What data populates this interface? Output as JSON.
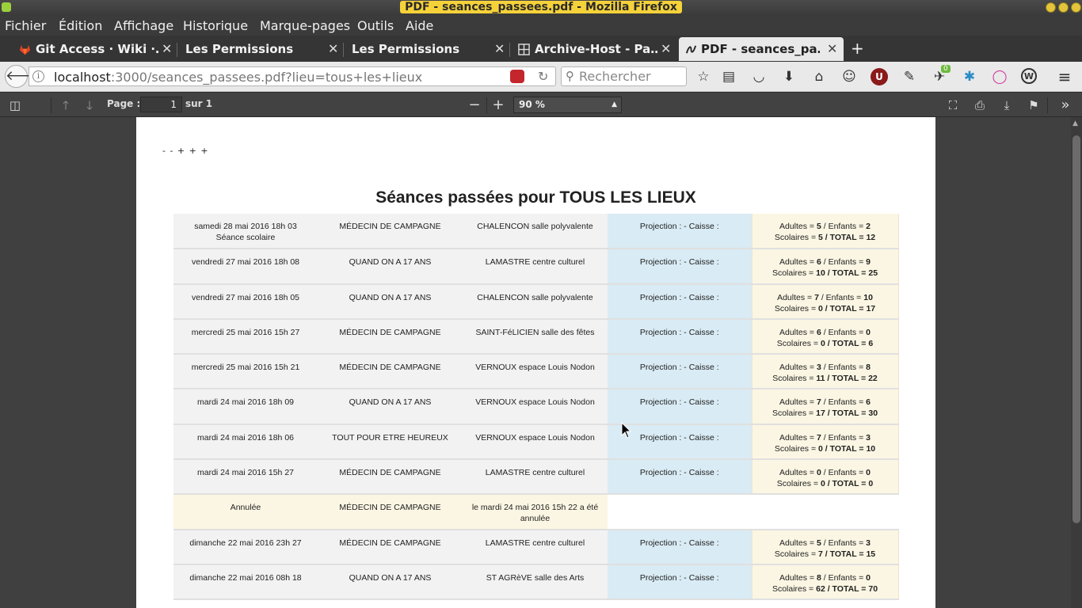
{
  "window": {
    "title": "PDF - seances_passees.pdf - Mozilla Firefox"
  },
  "menu": [
    "Fichier",
    "Édition",
    "Affichage",
    "Historique",
    "Marque-pages",
    "Outils",
    "Aide"
  ],
  "tabs": [
    {
      "label": "Git Access · Wiki ·…",
      "icon": "gitlab-icon",
      "active": false
    },
    {
      "label": "Les Permissions",
      "icon": "",
      "active": false
    },
    {
      "label": "Les Permissions",
      "icon": "",
      "active": false
    },
    {
      "label": "Archive-Host - Pa…",
      "icon": "grid-icon",
      "active": false
    },
    {
      "label": "PDF - seances_pa…",
      "icon": "pdf-icon",
      "active": true
    }
  ],
  "nav": {
    "url_host": "localhost",
    "url_rest": ":3000/seances_passees.pdf?lieu=tous+les+lieux",
    "search_placeholder": "Rechercher",
    "extension_badge": "0"
  },
  "pdf_toolbar": {
    "page_label": "Page :",
    "page_value": "1",
    "page_count": "sur 1",
    "zoom": "90 %"
  },
  "document": {
    "header_line": "- - + + +",
    "title": "Séances passées pour TOUS LES LIEUX",
    "rows": [
      {
        "date": "samedi 28 mai 2016 18h 03",
        "date_note": "Séance scolaire",
        "film": "MÉDECIN DE CAMPAGNE",
        "lieu": "CHALENCON salle polyvalente",
        "caisse": "Projection : - Caisse :",
        "adultes": "5",
        "enfants": "2",
        "scolaires": "5",
        "total": "12"
      },
      {
        "date": "vendredi 27 mai 2016 18h 08",
        "date_note": "",
        "film": "QUAND ON A 17 ANS",
        "lieu": "LAMASTRE centre culturel",
        "caisse": "Projection : - Caisse :",
        "adultes": "6",
        "enfants": "9",
        "scolaires": "10",
        "total": "25"
      },
      {
        "date": "vendredi 27 mai 2016 18h 05",
        "date_note": "",
        "film": "QUAND ON A 17 ANS",
        "lieu": "CHALENCON salle polyvalente",
        "caisse": "Projection : - Caisse :",
        "adultes": "7",
        "enfants": "10",
        "scolaires": "0",
        "total": "17"
      },
      {
        "date": "mercredi 25 mai 2016 15h 27",
        "date_note": "",
        "film": "MÉDECIN DE CAMPAGNE",
        "lieu": "SAINT-FéLICIEN salle des fêtes",
        "caisse": "Projection : - Caisse :",
        "adultes": "6",
        "enfants": "0",
        "scolaires": "0",
        "total": "6"
      },
      {
        "date": "mercredi 25 mai 2016 15h 21",
        "date_note": "",
        "film": "MÉDECIN DE CAMPAGNE",
        "lieu": "VERNOUX espace Louis Nodon",
        "caisse": "Projection : - Caisse :",
        "adultes": "3",
        "enfants": "8",
        "scolaires": "11",
        "total": "22"
      },
      {
        "date": "mardi 24 mai 2016 18h 09",
        "date_note": "",
        "film": "QUAND ON A 17 ANS",
        "lieu": "VERNOUX espace Louis Nodon",
        "caisse": "Projection : - Caisse :",
        "adultes": "7",
        "enfants": "6",
        "scolaires": "17",
        "total": "30"
      },
      {
        "date": "mardi 24 mai 2016 18h 06",
        "date_note": "",
        "film": "TOUT POUR ETRE HEUREUX",
        "lieu": "VERNOUX espace Louis Nodon",
        "caisse": "Projection : - Caisse :",
        "adultes": "7",
        "enfants": "3",
        "scolaires": "0",
        "total": "10"
      },
      {
        "date": "mardi 24 mai 2016 15h 27",
        "date_note": "",
        "film": "MÉDECIN DE CAMPAGNE",
        "lieu": "LAMASTRE centre culturel",
        "caisse": "Projection : - Caisse :",
        "adultes": "0",
        "enfants": "0",
        "scolaires": "0",
        "total": "0"
      },
      {
        "annulee": true,
        "date": "Annulée",
        "film": "MÉDECIN DE CAMPAGNE",
        "lieu": "le mardi 24 mai 2016 15h 22 a été annulée"
      },
      {
        "date": "dimanche 22 mai 2016 23h 27",
        "date_note": "",
        "film": "MÉDECIN DE CAMPAGNE",
        "lieu": "LAMASTRE centre culturel",
        "caisse": "Projection : - Caisse :",
        "adultes": "5",
        "enfants": "3",
        "scolaires": "7",
        "total": "15"
      },
      {
        "date": "dimanche 22 mai 2016 08h 18",
        "date_note": "",
        "film": "QUAND ON A 17 ANS",
        "lieu": "ST AGRèVE salle des Arts",
        "caisse": "Projection : - Caisse :",
        "adultes": "8",
        "enfants": "0",
        "scolaires": "62",
        "total": "70"
      }
    ],
    "labels": {
      "adultes": "Adultes = ",
      "enfants": " / Enfants = ",
      "scolaires": "Scolaires = ",
      "total": " / TOTAL = "
    }
  }
}
